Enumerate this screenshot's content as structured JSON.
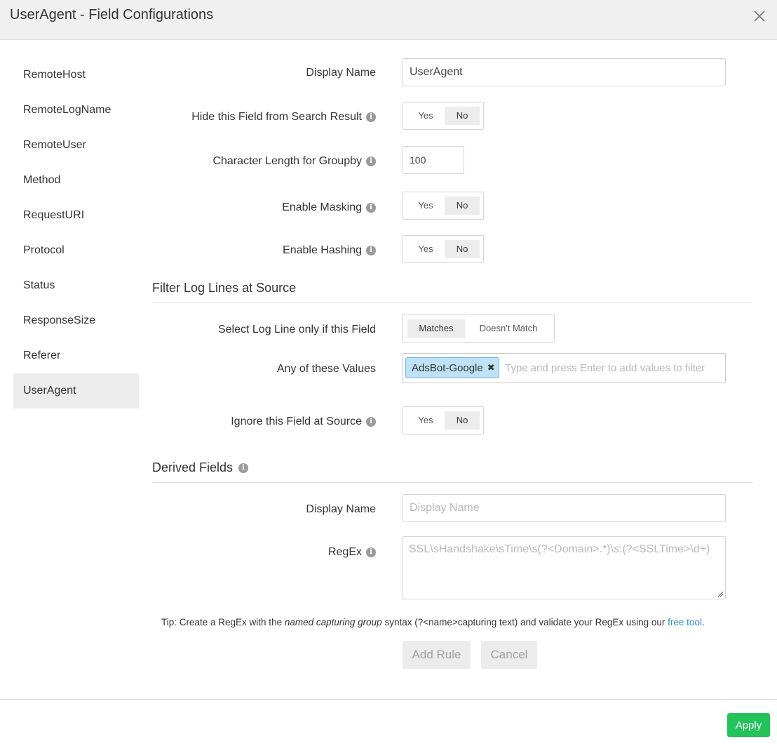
{
  "header": {
    "title": "UserAgent - Field Configurations",
    "close_icon": "close-icon"
  },
  "sidebar": {
    "items": [
      {
        "label": "RemoteHost"
      },
      {
        "label": "RemoteLogName"
      },
      {
        "label": "RemoteUser"
      },
      {
        "label": "Method"
      },
      {
        "label": "RequestURI"
      },
      {
        "label": "Protocol"
      },
      {
        "label": "Status"
      },
      {
        "label": "ResponseSize"
      },
      {
        "label": "Referer"
      },
      {
        "label": "UserAgent",
        "active": true
      }
    ]
  },
  "form": {
    "display_name": {
      "label": "Display Name",
      "value": "UserAgent"
    },
    "hide_field": {
      "label": "Hide this Field from Search Result",
      "yes": "Yes",
      "no": "No",
      "selected": "No"
    },
    "char_length": {
      "label": "Character Length for Groupby",
      "value": "100"
    },
    "masking": {
      "label": "Enable Masking",
      "yes": "Yes",
      "no": "No",
      "selected": "No"
    },
    "hashing": {
      "label": "Enable Hashing",
      "yes": "Yes",
      "no": "No",
      "selected": "No"
    }
  },
  "filter_section": {
    "title": "Filter Log Lines at Source",
    "select_line": {
      "label": "Select Log Line only if this Field",
      "matches": "Matches",
      "doesnt_match": "Doesn't Match",
      "selected": "Matches"
    },
    "values": {
      "label": "Any of these Values",
      "tags": [
        "AdsBot-Google"
      ],
      "placeholder": "Type and press Enter to add values to filter"
    },
    "ignore": {
      "label": "Ignore this Field at Source",
      "yes": "Yes",
      "no": "No",
      "selected": "No"
    }
  },
  "derived_section": {
    "title": "Derived Fields",
    "display_name": {
      "label": "Display Name",
      "placeholder": "Display Name"
    },
    "regex": {
      "label": "RegEx",
      "placeholder": "SSL\\sHandshake\\sTime\\s(?<Domain>.*)\\s:(?<SSLTime>\\d+)"
    },
    "tip": {
      "prefix": "Tip: Create a RegEx with the ",
      "emphasis": "named capturing group",
      "middle": " syntax (?<name>capturing text) and validate your RegEx using our ",
      "link": "free tool",
      "suffix": "."
    },
    "add_rule": "Add Rule",
    "cancel": "Cancel"
  },
  "footer": {
    "apply": "Apply"
  },
  "colors": {
    "apply_green": "#22c35a",
    "tag_blue": "#bfe2f7",
    "link_blue": "#2b8fd6"
  }
}
